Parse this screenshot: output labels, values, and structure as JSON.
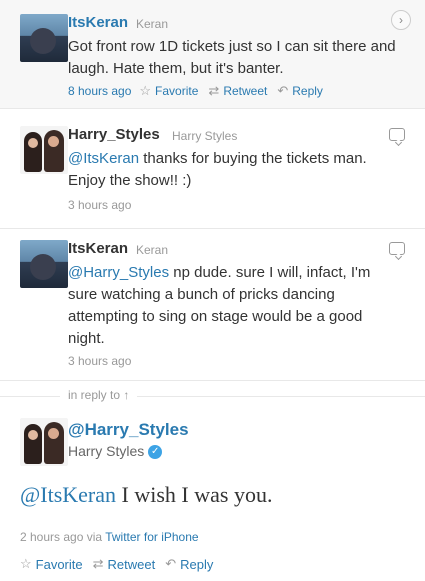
{
  "tweets": [
    {
      "username": "ItsKeran",
      "realname": "Keran",
      "text": "Got front row 1D tickets just so I can sit there and laugh. Hate them, but it's banter.",
      "time": "8 hours ago",
      "actions": {
        "favorite": "Favorite",
        "retweet": "Retweet",
        "reply": "Reply"
      }
    },
    {
      "username": "Harry_Styles",
      "realname": "Harry Styles",
      "mention": "@ItsKeran",
      "text": " thanks for buying the tickets man. Enjoy the show!! :)",
      "time": "3 hours ago"
    },
    {
      "username": "ItsKeran",
      "realname": "Keran",
      "mention": "@Harry_Styles",
      "text": " np dude. sure I will, infact, I'm sure watching a bunch of pricks dancing attempting to sing on stage would be a good night.",
      "time": "3 hours ago"
    }
  ],
  "in_reply_to": "in reply to ↑",
  "main_tweet": {
    "username": "@Harry_Styles",
    "realname": "Harry Styles",
    "mention": "@ItsKeran",
    "text": " I wish I was you.",
    "time": "2 hours ago",
    "via_label": "via",
    "source": "Twitter for iPhone",
    "actions": {
      "favorite": "Favorite",
      "retweet": "Retweet",
      "reply": "Reply"
    }
  },
  "icons": {
    "favorite": "star-icon",
    "retweet": "retweet-icon",
    "reply": "reply-icon",
    "expand": "chevron-right-icon",
    "conversation": "speech-bubble-icon",
    "verified": "verified-badge-icon"
  }
}
